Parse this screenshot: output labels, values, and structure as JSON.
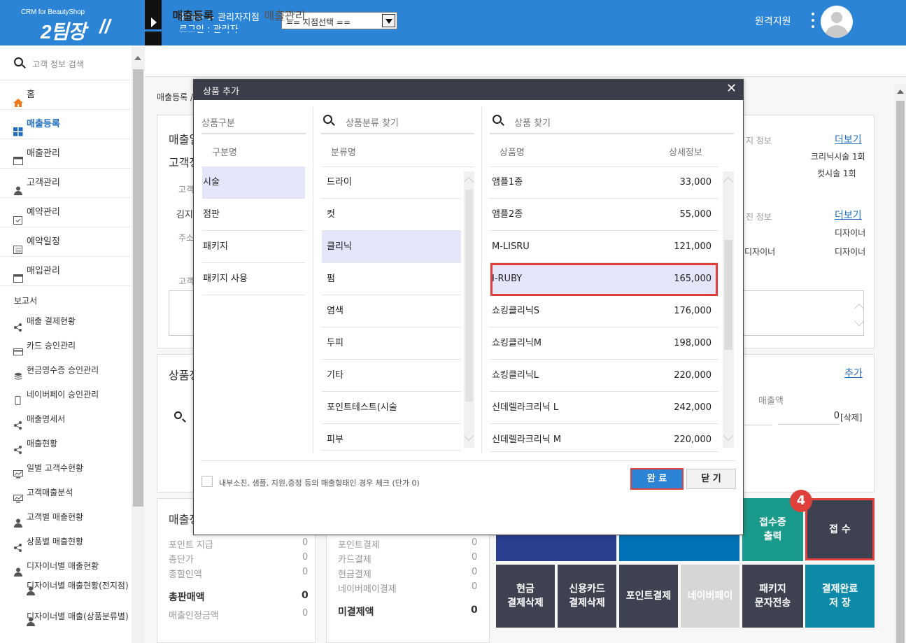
{
  "header": {
    "logo_sub": "CRM for BeautyShop",
    "logo_main": "2팀장",
    "logo_slash": "//",
    "user_line1": "화미주 > 관리자지점",
    "user_line2": "로그인 : 관리자",
    "branch_select": "== 지점선택 ==",
    "remote_support": "원격지원"
  },
  "sidebar": {
    "search_placeholder": "고객 정보 검색",
    "items": [
      {
        "label": "홈",
        "icon": "home-icon"
      },
      {
        "label": "매출등록",
        "icon": "grid-icon"
      },
      {
        "label": "매출관리",
        "icon": "window-icon"
      },
      {
        "label": "고객관리",
        "icon": "user-icon"
      },
      {
        "label": "예약관리",
        "icon": "calendar-check-icon"
      },
      {
        "label": "예약일정",
        "icon": "calendar-icon"
      },
      {
        "label": "매입관리",
        "icon": "window-icon"
      }
    ],
    "report_label": "보고서",
    "reports": [
      {
        "label": "매출 결제현황",
        "icon": "share-icon"
      },
      {
        "label": "카드 승인관리",
        "icon": "card-icon"
      },
      {
        "label": "현금영수증 승인관리",
        "icon": "cash-icon"
      },
      {
        "label": "네이버페이 승인관리",
        "icon": "mobile-icon"
      },
      {
        "label": "매출명세서",
        "icon": "share-icon"
      },
      {
        "label": "매출현황",
        "icon": "share-icon"
      },
      {
        "label": "일별 고객수현황",
        "icon": "chart-icon"
      },
      {
        "label": "고객매출분석",
        "icon": "chart-icon"
      },
      {
        "label": "고객별 매출현황",
        "icon": "user-icon"
      },
      {
        "label": "상품별 매출현황",
        "icon": "share-icon"
      },
      {
        "label": "디자이너별 매출현황",
        "icon": "user-icon"
      },
      {
        "label": "디자이너별 매출현황(전지점)",
        "icon": "user-icon"
      },
      {
        "label": "디자이너별 매출(상품분류별)",
        "icon": "user-icon"
      }
    ]
  },
  "tabs": {
    "sales_register": "매출등록",
    "sales_manage": "매출관리"
  },
  "background": {
    "breadcrumb": "매출등록 /",
    "card1_title": "매출일",
    "card1_sub": "고객정",
    "customer_label": "고객",
    "customer_name": "김지",
    "address_label": "주소",
    "customer_label2": "고객",
    "more1": "더보기",
    "info1_label": "지 정보",
    "info1_line1": "크리닉시술 1회",
    "info1_line2": "컷시술 1회",
    "more2": "더보기",
    "info2_label": "진 정보",
    "info2_line1": "디자이너",
    "info2_line2a": "디자이너",
    "info2_line2b": "디자이너",
    "product_title": "상품정",
    "add_link": "추가",
    "sales_amount_label": "매출액",
    "sales_amount": "0",
    "delete_link": "[삭제]",
    "summary_title": "매출정",
    "left_summary": [
      {
        "label": "포인트 지급",
        "value": "0"
      },
      {
        "label": "총단가",
        "value": "0"
      },
      {
        "label": "총할인액",
        "value": "0"
      }
    ],
    "total_sales_label": "총판매액",
    "total_sales_value": "0",
    "confirm_label": "매출인정금액",
    "confirm_value": "0",
    "right_summary": [
      {
        "label": "포인트결제",
        "value": "0"
      },
      {
        "label": "카드결제",
        "value": "0"
      },
      {
        "label": "현금결제",
        "value": "0"
      },
      {
        "label": "네이버페이결제",
        "value": "0"
      }
    ],
    "unpaid_label": "미결제액",
    "unpaid_value": "0"
  },
  "actions": {
    "receipt_print": "접수증\n출력",
    "receive": "접 수",
    "step_badge": "4",
    "cash_delete": "현금\n결제삭제",
    "card_delete": "신용카드\n결제삭제",
    "point_pay": "포인트결제",
    "naver_pay": "네이버페이",
    "package_sms": "패키지\n문자전송",
    "complete_save": "결제완료\n저 장"
  },
  "modal": {
    "title": "상품 추가",
    "close": "✕",
    "col1_search": "상품구분",
    "col1_header": "구분명",
    "col1_items": [
      "시술",
      "점판",
      "패키지",
      "패키지 사용"
    ],
    "col1_selected": 0,
    "col2_search": "상품분류 찾기",
    "col2_header": "분류명",
    "col2_items": [
      "드라이",
      "컷",
      "클리닉",
      "펌",
      "염색",
      "두피",
      "기타",
      "포인트테스트(시술",
      "피부"
    ],
    "col2_selected": 2,
    "col3_search": "상품 찾기",
    "col3_header_name": "상품명",
    "col3_header_detail": "상세정보",
    "col3_items": [
      {
        "name": "앰플1종",
        "price": "33,000"
      },
      {
        "name": "앰플2종",
        "price": "55,000"
      },
      {
        "name": "M-LISRU",
        "price": "121,000"
      },
      {
        "name": "I-RUBY",
        "price": "165,000"
      },
      {
        "name": "쇼킹클리닉S",
        "price": "176,000"
      },
      {
        "name": "쇼킹클리닉M",
        "price": "198,000"
      },
      {
        "name": "쇼킹클리닉L",
        "price": "220,000"
      },
      {
        "name": "신데렐라크리닉 L",
        "price": "242,000"
      },
      {
        "name": "신데렐라크리닉 M",
        "price": "220,000"
      }
    ],
    "col3_selected": 3,
    "checkbox_label": "내부소진, 샘플, 지원,증정 등의 매출형태인 경우 체크 (단가 0)",
    "complete_button": "완 료",
    "close_button": "닫 기"
  },
  "colors": {
    "header_blue": "#2b84d6",
    "modal_header": "#3a3d4a",
    "selected_row": "#e6e6fb",
    "highlight_red": "#e0403c",
    "btn_dark": "#3e4150",
    "btn_teal": "#1a9a8a",
    "btn_blue": "#0072b5",
    "btn_navy": "#2b3f8f",
    "btn_cyan": "#0e8aa8"
  }
}
